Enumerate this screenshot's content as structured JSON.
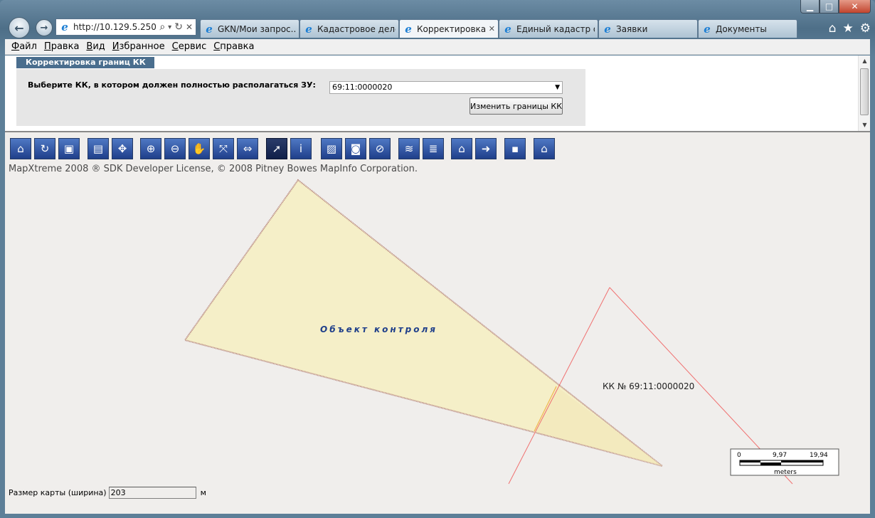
{
  "window": {
    "caption_buttons": {
      "minimize": "▁",
      "maximize": "□",
      "close": "✕"
    }
  },
  "browser": {
    "address": "http://10.129.5.250/",
    "address_icons": {
      "search": "⌕",
      "dropdown": "▾",
      "refresh": "↻",
      "stop": "✕"
    },
    "tabs": [
      {
        "label": "GKN/Мои запрос...",
        "active": false
      },
      {
        "label": "Кадастровое деле...",
        "active": false
      },
      {
        "label": "Корректировка ...",
        "active": true
      },
      {
        "label": "Единый кадастр о...",
        "active": false
      },
      {
        "label": "Заявки",
        "active": false
      },
      {
        "label": "Документы",
        "active": false
      }
    ],
    "tools": {
      "home": "⌂",
      "favorites": "★",
      "settings": "⚙"
    }
  },
  "menu": {
    "file": {
      "hotkey": "Ф",
      "rest": "айл"
    },
    "edit": {
      "hotkey": "П",
      "rest": "равка"
    },
    "view": {
      "hotkey": "В",
      "rest": "ид"
    },
    "favorites": {
      "hotkey": "И",
      "rest": "збранное"
    },
    "service": {
      "hotkey": "С",
      "rest": "ервис"
    },
    "help": {
      "hotkey": "С",
      "rest": "правка"
    }
  },
  "page": {
    "panel_title": "Корректировка границ КК",
    "select_label": "Выберите КК, в котором должен полностью располагаться ЗУ:",
    "select_value": "69:11:0000020",
    "change_button": "Изменить границы КК",
    "copyright": "MapXtreme 2008 ® SDK Developer License, © 2008 Pitney Bowes MapInfo Corporation.",
    "map_size_label": "Размер карты (ширина)",
    "map_size_value": "203",
    "map_size_unit": "м"
  },
  "toolbar": [
    {
      "name": "home-tool-icon",
      "glyph": "⌂"
    },
    {
      "name": "refresh-tool-icon",
      "glyph": "↻"
    },
    {
      "name": "monitor-tool-icon",
      "glyph": "▣"
    },
    {
      "name": "layer-view-tool-icon",
      "glyph": "▤"
    },
    {
      "name": "pan-arrows-tool-icon",
      "glyph": "✥"
    },
    {
      "name": "zoom-in-tool-icon",
      "glyph": "⊕"
    },
    {
      "name": "zoom-out-tool-icon",
      "glyph": "⊖"
    },
    {
      "name": "hand-pan-tool-icon",
      "glyph": "✋"
    },
    {
      "name": "zoom-extent-tool-icon",
      "glyph": "⤧"
    },
    {
      "name": "ruler-tool-icon",
      "glyph": "⇔"
    },
    {
      "name": "select-arrow-tool-icon",
      "glyph": "➚",
      "selected": true
    },
    {
      "name": "info-tool-icon",
      "glyph": "i"
    },
    {
      "name": "picture-tool-icon",
      "glyph": "▨"
    },
    {
      "name": "camera-tool-icon",
      "glyph": "◙"
    },
    {
      "name": "camera-disabled-tool-icon",
      "glyph": "⊘"
    },
    {
      "name": "layers-tool-icon",
      "glyph": "≋"
    },
    {
      "name": "layers-edit-tool-icon",
      "glyph": "≣"
    },
    {
      "name": "polygon-tool-icon",
      "glyph": "⌂"
    },
    {
      "name": "export-tool-icon",
      "glyph": "➜"
    },
    {
      "name": "save-tool-icon",
      "glyph": "▪"
    },
    {
      "name": "houses-tool-icon",
      "glyph": "⌂"
    }
  ],
  "map": {
    "object_label": "Объект контроля",
    "kk_label": "КК № 69:11:0000020",
    "colors": {
      "object_fill": "#f5efc8",
      "object_stroke": "#b07a72",
      "kk_line": "#f07070",
      "overlap": "#f0b040"
    },
    "scale": {
      "ticks": [
        "0",
        "9,97",
        "19,94"
      ],
      "unit": "meters"
    }
  }
}
